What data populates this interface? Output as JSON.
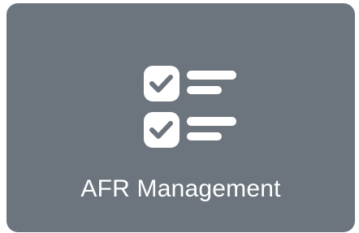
{
  "tile": {
    "label": "AFR Management",
    "icon": "checklist-icon",
    "background_color": "#6c757d",
    "foreground_color": "#ffffff"
  }
}
